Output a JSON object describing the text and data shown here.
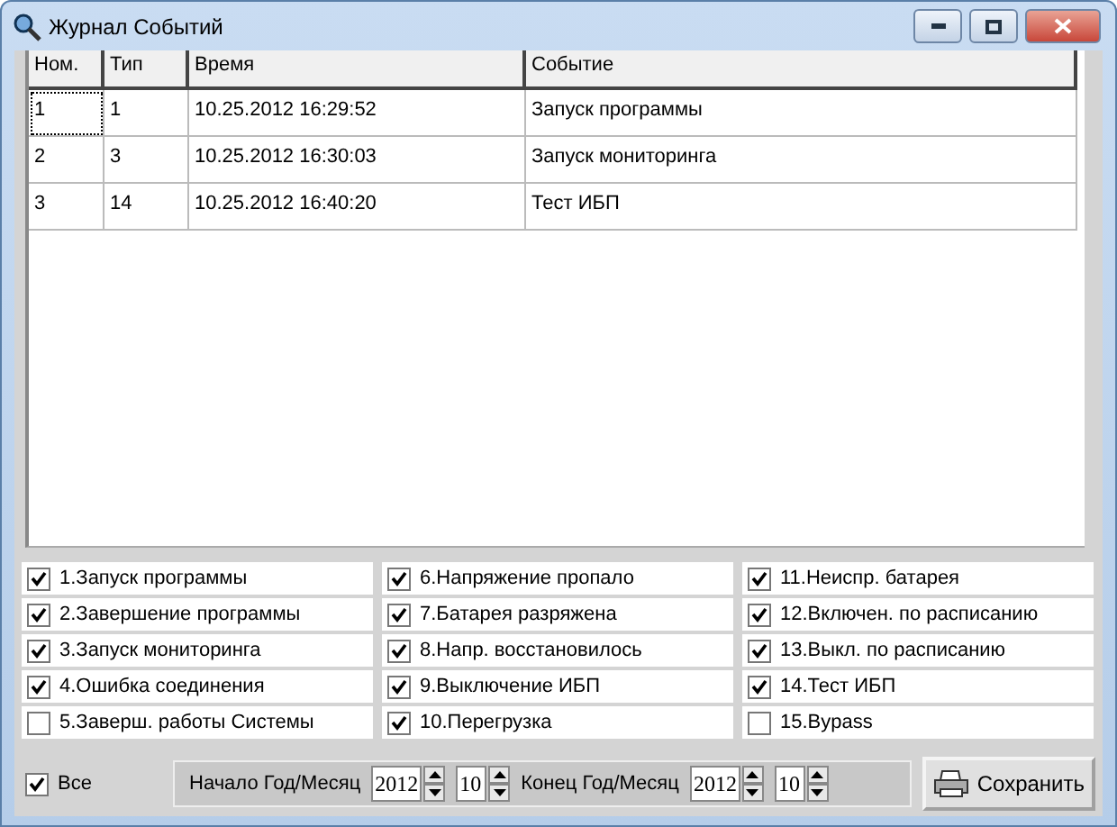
{
  "window": {
    "title": "Журнал Событий"
  },
  "table": {
    "columns": [
      "Ном.",
      "Тип",
      "Время",
      "Событие"
    ],
    "rows": [
      {
        "cells": [
          "1",
          "1",
          "10.25.2012 16:29:52",
          "Запуск программы"
        ],
        "selected": true
      },
      {
        "cells": [
          "2",
          "3",
          "10.25.2012 16:30:03",
          "Запуск мониторинга"
        ],
        "selected": false
      },
      {
        "cells": [
          "3",
          "14",
          "10.25.2012 16:40:20",
          "Тест ИБП"
        ],
        "selected": false
      }
    ]
  },
  "filters": [
    {
      "label": "1.Запуск программы",
      "checked": true
    },
    {
      "label": "2.Завершение программы",
      "checked": true
    },
    {
      "label": "3.Запуск мониторинга",
      "checked": true
    },
    {
      "label": "4.Ошибка соединения",
      "checked": true
    },
    {
      "label": "5.Заверш. работы Системы",
      "checked": false
    },
    {
      "label": "6.Напряжение пропало",
      "checked": true
    },
    {
      "label": "7.Батарея разряжена",
      "checked": true
    },
    {
      "label": "8.Напр. восстановилось",
      "checked": true
    },
    {
      "label": "9.Выключение ИБП",
      "checked": true
    },
    {
      "label": "10.Перегрузка",
      "checked": true
    },
    {
      "label": "11.Неиспр. батарея",
      "checked": true
    },
    {
      "label": "12.Включен. по расписанию",
      "checked": true
    },
    {
      "label": "13.Выкл. по расписанию",
      "checked": true
    },
    {
      "label": "14.Тест ИБП",
      "checked": true
    },
    {
      "label": "15.Bypass",
      "checked": false
    }
  ],
  "all": {
    "label": "Все",
    "checked": true
  },
  "start": {
    "label": "Начало Год/Месяц",
    "year": "2012",
    "month": "10"
  },
  "end": {
    "label": "Конец Год/Месяц",
    "year": "2012",
    "month": "10"
  },
  "save_button": "Сохранить"
}
